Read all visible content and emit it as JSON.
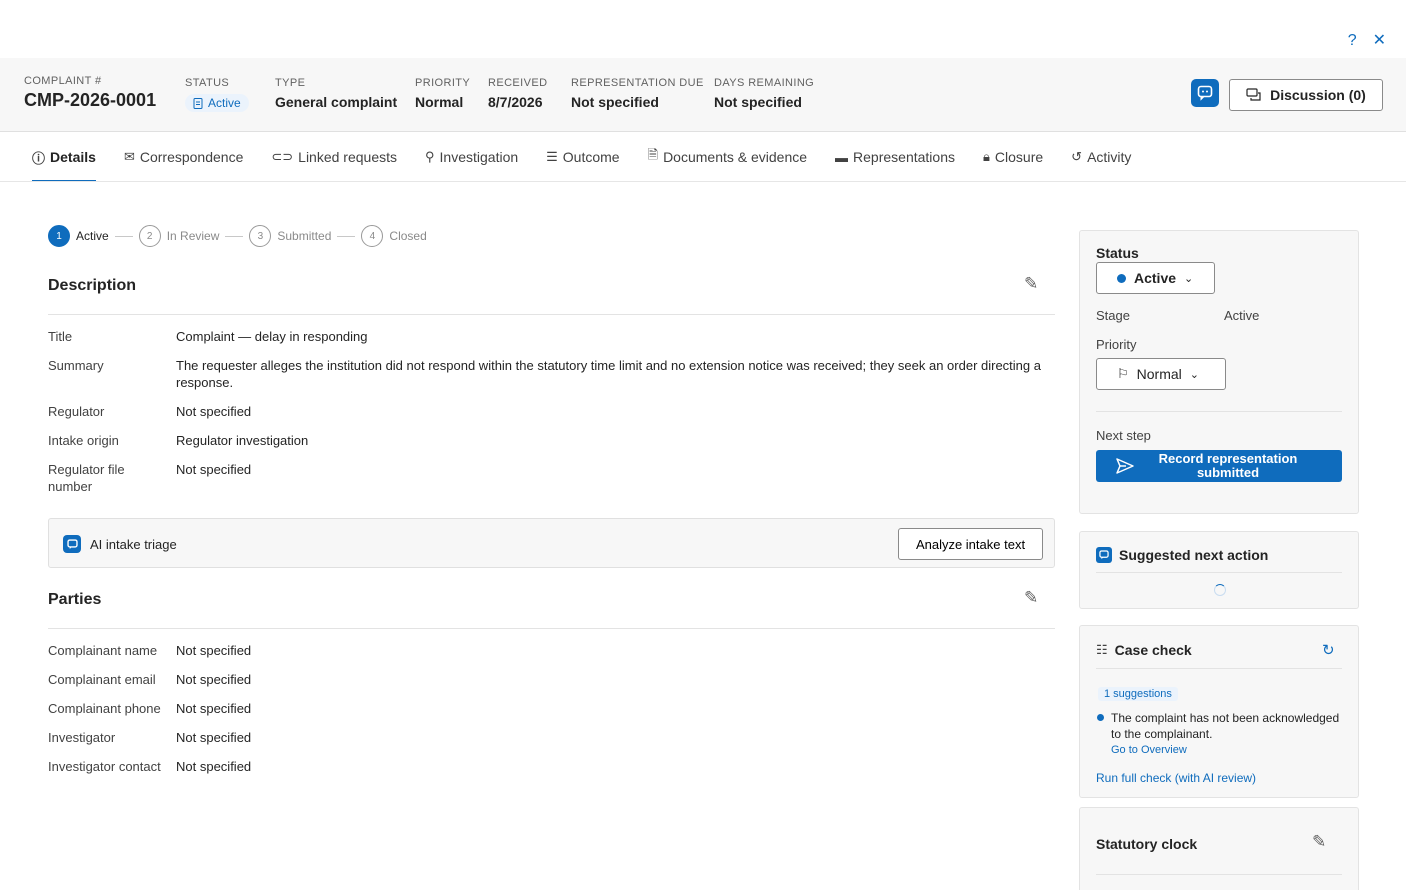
{
  "window": {
    "help_icon": "question-icon",
    "close_icon": "close-icon"
  },
  "header": {
    "complaint_label": "COMPLAINT #",
    "complaint_number": "CMP-2026-0001",
    "status_label": "STATUS",
    "status_value": "Active",
    "type_label": "TYPE",
    "type_value": "General complaint",
    "priority_label": "PRIORITY",
    "priority_value": "Normal",
    "received_label": "RECEIVED",
    "received_value": "8/7/2026",
    "rep_due_label": "REPRESENTATION DUE",
    "rep_due_value": "Not specified",
    "days_label": "DAYS REMAINING",
    "days_value": "Not specified",
    "discussion_label": "Discussion (0)"
  },
  "tabs": [
    {
      "label": "Details",
      "icon": "info-icon"
    },
    {
      "label": "Correspondence",
      "icon": "mail-icon"
    },
    {
      "label": "Linked requests",
      "icon": "link-icon"
    },
    {
      "label": "Investigation",
      "icon": "investigation-icon"
    },
    {
      "label": "Outcome",
      "icon": "checklist-icon"
    },
    {
      "label": "Documents & evidence",
      "icon": "document-icon"
    },
    {
      "label": "Representations",
      "icon": "representations-icon"
    },
    {
      "label": "Closure",
      "icon": "lock-icon"
    },
    {
      "label": "Activity",
      "icon": "history-icon"
    }
  ],
  "steps": [
    {
      "num": "1",
      "label": "Active"
    },
    {
      "num": "2",
      "label": "In Review"
    },
    {
      "num": "3",
      "label": "Submitted"
    },
    {
      "num": "4",
      "label": "Closed"
    }
  ],
  "description": {
    "heading": "Description",
    "fields": [
      {
        "key": "Title",
        "value": "Complaint — delay in responding"
      },
      {
        "key": "Summary",
        "value": "The requester alleges the institution did not respond within the statutory time limit and no extension notice was received; they seek an order directing a response."
      },
      {
        "key": "Regulator",
        "value": "Not specified"
      },
      {
        "key": "Intake origin",
        "value": "Regulator investigation"
      },
      {
        "key": "Regulator file number",
        "value": "Not specified"
      }
    ]
  },
  "ai_triage": {
    "label": "AI intake triage",
    "button": "Analyze intake text"
  },
  "parties": {
    "heading": "Parties",
    "fields": [
      {
        "key": "Complainant name",
        "value": "Not specified"
      },
      {
        "key": "Complainant email",
        "value": "Not specified"
      },
      {
        "key": "Complainant phone",
        "value": "Not specified"
      },
      {
        "key": "Investigator",
        "value": "Not specified"
      },
      {
        "key": "Investigator contact",
        "value": "Not specified"
      }
    ]
  },
  "status_card": {
    "status_label": "Status",
    "status_value": "Active",
    "stage_label": "Stage",
    "stage_value": "Active",
    "priority_label": "Priority",
    "priority_value": "Normal",
    "next_step_label": "Next step",
    "next_step_button": "Record representation submitted"
  },
  "suggested": {
    "heading": "Suggested next action"
  },
  "case_check": {
    "heading": "Case check",
    "suggestions_badge": "1 suggestions",
    "item_text": "The complaint has not been acknowledged to the complainant.",
    "item_link": "Go to Overview",
    "run_link": "Run full check (with AI review)"
  },
  "statutory": {
    "heading": "Statutory clock"
  },
  "colors": {
    "accent": "#0f6cbd",
    "header_bg": "#f7f7f7"
  }
}
